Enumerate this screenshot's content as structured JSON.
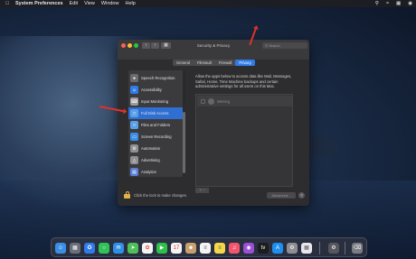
{
  "menubar": {
    "apple_icon": "apple-icon",
    "app_name": "System Preferences",
    "items": [
      "Edit",
      "View",
      "Window",
      "Help"
    ],
    "status_icons": [
      "spotlight-icon",
      "wifi-icon",
      "control-center-icon",
      "siri-icon"
    ]
  },
  "window": {
    "title": "Security & Privacy",
    "search_placeholder": "Search",
    "tabs": [
      "General",
      "FileVault",
      "Firewall",
      "Privacy"
    ],
    "active_tab": "Privacy",
    "sidebar": {
      "items": [
        {
          "label": "Speech Recognition",
          "icon": "microphone-icon",
          "color": "#6c6c70"
        },
        {
          "label": "Accessibility",
          "icon": "accessibility-icon",
          "color": "#2f7bea"
        },
        {
          "label": "Input Monitoring",
          "icon": "keyboard-icon",
          "color": "#9a9a9e"
        },
        {
          "label": "Full Disk Access",
          "icon": "folder-icon",
          "color": "#5aa0e8",
          "selected": true
        },
        {
          "label": "Files and Folders",
          "icon": "folder-icon",
          "color": "#5aa0e8"
        },
        {
          "label": "Screen Recording",
          "icon": "screen-icon",
          "color": "#3a8ee6"
        },
        {
          "label": "Automation",
          "icon": "gear-icon",
          "color": "#8e8e93"
        },
        {
          "label": "Advertising",
          "icon": "megaphone-icon",
          "color": "#8e8e93"
        },
        {
          "label": "Analytics",
          "icon": "chart-icon",
          "color": "#5a7fd6"
        }
      ]
    },
    "description": "Allow the apps below to access data like Mail, Messages, Safari, Home, Time Machine backups and certain administrative settings for all users on this Mac.",
    "apps": [
      {
        "name": "Missing",
        "checked": false
      }
    ],
    "add_remove": "+ −",
    "lock_text": "Click the lock to make changes.",
    "advanced_label": "Advanced...",
    "help_label": "?"
  },
  "dock": {
    "icons": [
      "finder-icon",
      "launchpad-icon",
      "safari-icon",
      "messages-icon",
      "mail-icon",
      "maps-icon",
      "photos-icon",
      "facetime-icon",
      "calendar-icon",
      "contacts-icon",
      "reminders-icon",
      "notes-icon",
      "music-icon",
      "podcasts-icon",
      "tv-icon",
      "app-store-icon",
      "system-preferences-icon",
      "terminal-icon",
      "trash-icon"
    ]
  }
}
